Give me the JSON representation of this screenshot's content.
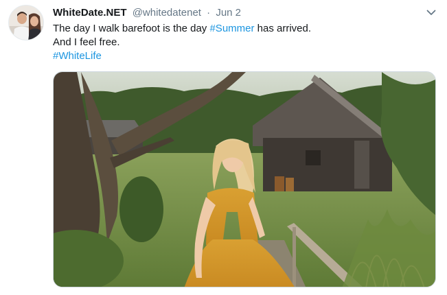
{
  "tweet": {
    "display_name": "WhiteDate.NET",
    "handle": "@whitedatenet",
    "separator": "·",
    "date": "Jun 2",
    "line1_before": "The day I walk barefoot is the day ",
    "line1_hashtag": "#Summer",
    "line1_after": " has arrived.",
    "line2": "And I feel free.",
    "line3_hashtag": "#WhiteLife"
  },
  "icons": {
    "menu": "chevron-down-icon"
  },
  "colors": {
    "link": "#1b95e0",
    "secondary_text": "#657786",
    "primary_text": "#14171a",
    "dress": "#d9a032"
  }
}
